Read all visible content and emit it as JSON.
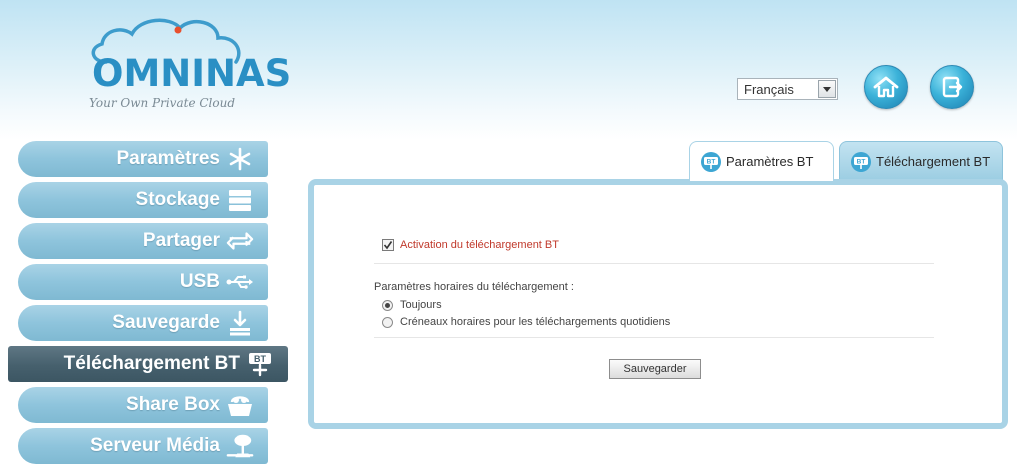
{
  "brand": {
    "name": "OMNINAS",
    "tagline": "Your Own Private Cloud",
    "color": "#2a8fc4"
  },
  "header": {
    "language": {
      "value": "Français"
    },
    "buttons": [
      {
        "icon": "home-icon"
      },
      {
        "icon": "exit-icon"
      }
    ]
  },
  "sidebar": {
    "items": [
      {
        "label": "Paramètres",
        "icon": "settings-icon",
        "active": false
      },
      {
        "label": "Stockage",
        "icon": "storage-icon",
        "active": false
      },
      {
        "label": "Partager",
        "icon": "share-icon",
        "active": false
      },
      {
        "label": "USB",
        "icon": "usb-icon",
        "active": false
      },
      {
        "label": "Sauvegarde",
        "icon": "backup-icon",
        "active": false
      },
      {
        "label": "Téléchargement BT",
        "icon": "bt-download-icon",
        "active": true
      },
      {
        "label": "Share Box",
        "icon": "share-box-icon",
        "active": false
      },
      {
        "label": "Serveur Média",
        "icon": "media-server-icon",
        "active": false
      }
    ]
  },
  "tabs": [
    {
      "label": "Paramètres BT",
      "active": true
    },
    {
      "label": "Téléchargement BT",
      "active": false
    }
  ],
  "form": {
    "enable_label": "Activation du téléchargement BT",
    "enable_checked": true,
    "schedule_title": "Paramètres horaires du téléchargement :",
    "options": [
      {
        "label": "Toujours",
        "selected": true
      },
      {
        "label": "Créneaux horaires pour les téléchargements quotidiens",
        "selected": false
      }
    ],
    "save_label": "Sauvegarder"
  },
  "colors": {
    "sidebar_bg": "#8ec4dc",
    "sidebar_active": "#46606d",
    "panel_border": "#a9d3e6",
    "accent_red": "#c0392b"
  }
}
